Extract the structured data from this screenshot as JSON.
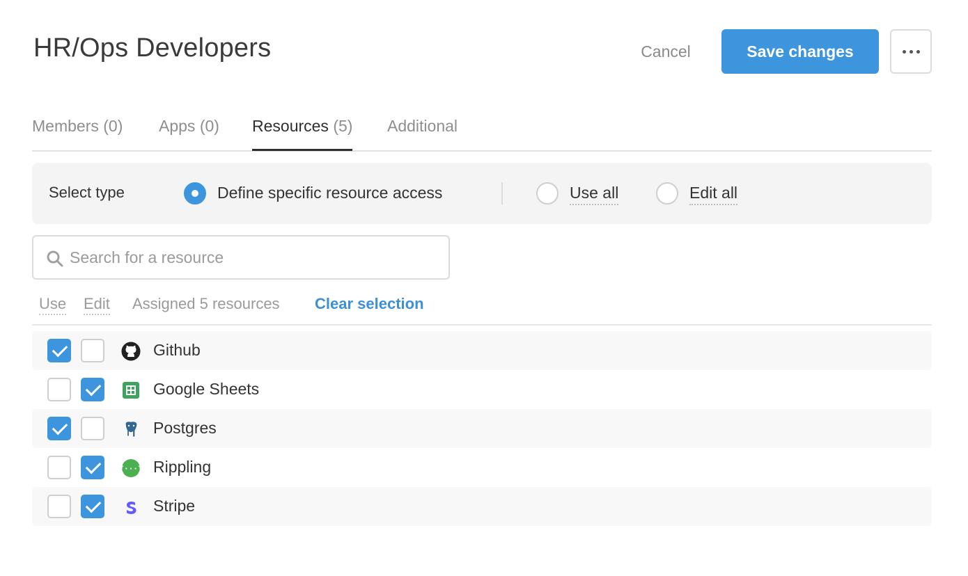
{
  "header": {
    "title": "HR/Ops Developers",
    "cancel_label": "Cancel",
    "save_label": "Save changes"
  },
  "tabs": [
    {
      "label": "Members",
      "count": "(0)"
    },
    {
      "label": "Apps",
      "count": "(0)"
    },
    {
      "label": "Resources",
      "count": "(5)",
      "active": true
    },
    {
      "label": "Additional",
      "count": ""
    }
  ],
  "select_type": {
    "label": "Select type",
    "options": [
      {
        "label": "Define specific resource access",
        "selected": true
      },
      {
        "label": "Use all",
        "selected": false
      },
      {
        "label": "Edit all",
        "selected": false
      }
    ]
  },
  "search": {
    "placeholder": "Search for a resource",
    "value": ""
  },
  "list_header": {
    "use_label": "Use",
    "edit_label": "Edit",
    "assigned_text": "Assigned 5 resources",
    "clear_label": "Clear selection"
  },
  "resources": [
    {
      "name": "Github",
      "icon": "github-icon",
      "use": true,
      "edit": false
    },
    {
      "name": "Google Sheets",
      "icon": "google-sheets-icon",
      "use": false,
      "edit": true
    },
    {
      "name": "Postgres",
      "icon": "postgres-icon",
      "use": true,
      "edit": false
    },
    {
      "name": "Rippling",
      "icon": "rippling-icon",
      "use": false,
      "edit": true
    },
    {
      "name": "Stripe",
      "icon": "stripe-icon",
      "use": false,
      "edit": true
    }
  ],
  "colors": {
    "accent": "#3d95de",
    "link": "#3d8fd6",
    "panel_bg": "#f4f4f4"
  }
}
